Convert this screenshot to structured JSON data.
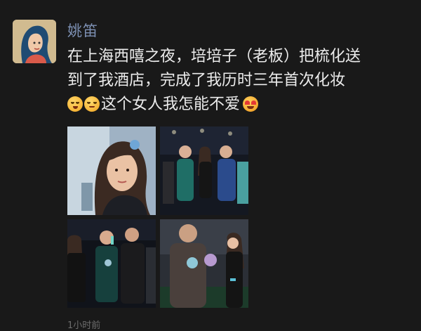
{
  "post": {
    "username": "姚笛",
    "text_line1": "在上海西嘻之夜，培培子（老板）把梳化送",
    "text_line2": "到了我酒店，完成了我历时三年首次化妆",
    "text_line3": "这个女人我怎能不爱",
    "emojis": [
      "thinking-face-icon",
      "smirk-face-icon",
      "heart-eyes-face-icon"
    ],
    "photos": [
      {
        "name": "woman-portrait-photo"
      },
      {
        "name": "group-event-photo"
      },
      {
        "name": "crowd-applause-photo"
      },
      {
        "name": "man-with-flowers-photo"
      }
    ],
    "time": "1小时前"
  },
  "colors": {
    "background": "#191919",
    "username": "#7d90b3",
    "text": "#ececec"
  }
}
